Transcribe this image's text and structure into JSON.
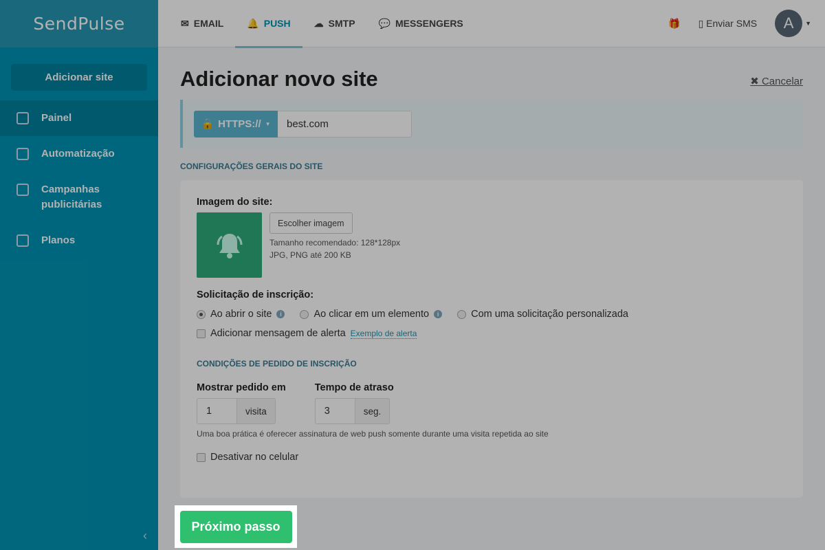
{
  "brand": {
    "logo": "SendPulse"
  },
  "sidebar": {
    "add_site": "Adicionar site",
    "items": [
      {
        "label": "Painel"
      },
      {
        "label": "Automatização"
      },
      {
        "label": "Campanhas publicitárias"
      },
      {
        "label": "Planos"
      }
    ],
    "collapse": "‹"
  },
  "topnav": {
    "tabs": [
      {
        "label": "EMAIL",
        "icon": "✉"
      },
      {
        "label": "PUSH",
        "icon": "🔔"
      },
      {
        "label": "SMTP",
        "icon": "☁"
      },
      {
        "label": "MESSENGERS",
        "icon": "💬"
      }
    ],
    "sms": "Enviar SMS",
    "avatar": "A"
  },
  "page": {
    "title": "Adicionar novo site",
    "cancel": "Cancelar",
    "protocol": "HTTPS://",
    "url": "best.com",
    "section_general": "Configurações gerais do site",
    "image_label": "Imagem do site:",
    "choose_image": "Escolher imagem",
    "image_hint1": "Tamanho recomendado: 128*128px",
    "image_hint2": "JPG, PNG até 200 KB",
    "request_label": "Solicitação de inscrição:",
    "radios": [
      {
        "label": "Ao abrir o site",
        "selected": true
      },
      {
        "label": "Ao clicar em um elemento",
        "selected": false
      },
      {
        "label": "Com uma solicitação personalizada",
        "selected": false
      }
    ],
    "alert_checkbox": "Adicionar mensagem de alerta",
    "alert_link": "Exemplo de alerta",
    "section_conditions": "Condições de pedido de inscrição",
    "show_label": "Mostrar pedido em",
    "show_value": "1",
    "show_unit": "visita",
    "delay_label": "Tempo de atraso",
    "delay_value": "3",
    "delay_unit": "seg.",
    "tip": "Uma boa prática é oferecer assinatura de web push somente durante uma visita repetida ao site",
    "mobile_checkbox": "Desativar no celular",
    "next": "Próximo passo"
  }
}
